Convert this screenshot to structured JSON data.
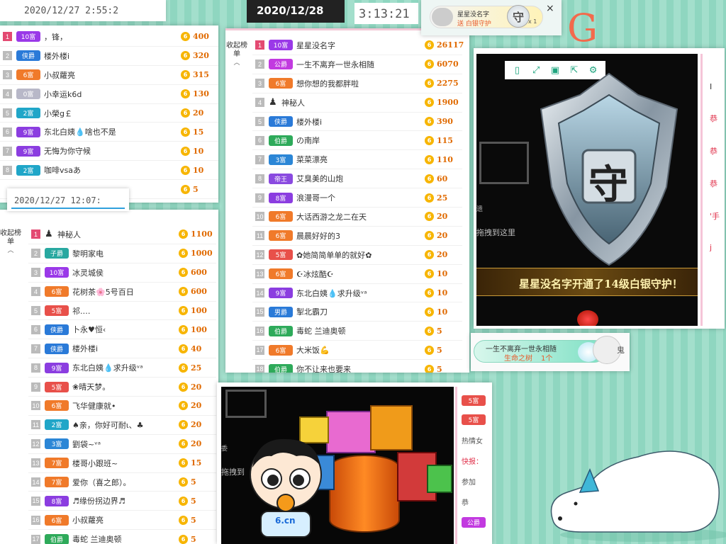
{
  "colors": {
    "rank_first": "#e34a72",
    "rank_default": "#bbbbbb",
    "coin": "#f7b500",
    "score": "#e06a00",
    "accent_teal": "#1fa57f"
  },
  "panel_top_left": {
    "timestamp": "2020/12/27 2:55:2",
    "rows": [
      {
        "rank": "1",
        "badge": "10富",
        "badge_color": "#9a39e8",
        "name": "，锋，",
        "score": "400"
      },
      {
        "rank": "2",
        "badge": "侠爵",
        "badge_color": "#2a7ad8",
        "name": "楼外楼i",
        "score": "320"
      },
      {
        "rank": "3",
        "badge": "6富",
        "badge_color": "#f07a2a",
        "name": "小叔蘿亮",
        "score": "315"
      },
      {
        "rank": "4",
        "badge": "0富",
        "badge_color": "#b8b8c8",
        "name": "小幸运k6d",
        "score": "130"
      },
      {
        "rank": "5",
        "badge": "2富",
        "badge_color": "#20a6c8",
        "name": "小榮g￡",
        "score": "20"
      },
      {
        "rank": "6",
        "badge": "9富",
        "badge_color": "#8b3de0",
        "name": "东北白姨💧啥也不是",
        "score": "15"
      },
      {
        "rank": "7",
        "badge": "9富",
        "badge_color": "#8b3de0",
        "name": "无悔为你守候",
        "score": "10"
      },
      {
        "rank": "8",
        "badge": "2富",
        "badge_color": "#20a6c8",
        "name": "咖啡vsaあ",
        "score": "10"
      },
      {
        "rank": "",
        "badge": "",
        "badge_color": "#ffffff",
        "name": "",
        "score": "5"
      }
    ]
  },
  "panel_bottom_left": {
    "timestamp": "2020/12/27 12:07:",
    "side_label": "收起榜单",
    "rows": [
      {
        "rank": "1",
        "badge": "",
        "badge_color": "#ffffff",
        "name": "神秘人",
        "score": "1100",
        "mystery": true
      },
      {
        "rank": "2",
        "badge": "子爵",
        "badge_color": "#28a8a0",
        "name": "黎明家电",
        "score": "1000"
      },
      {
        "rank": "3",
        "badge": "10富",
        "badge_color": "#9a39e8",
        "name": "冰灵城侯",
        "score": "600"
      },
      {
        "rank": "4",
        "badge": "6富",
        "badge_color": "#f07a2a",
        "name": "花树茶🌸5号百日",
        "score": "600"
      },
      {
        "rank": "5",
        "badge": "5富",
        "badge_color": "#e8504a",
        "name": "祁.…",
        "score": "100"
      },
      {
        "rank": "6",
        "badge": "侠爵",
        "badge_color": "#2a7ad8",
        "name": "卜永♥恒‹",
        "score": "100"
      },
      {
        "rank": "7",
        "badge": "侠爵",
        "badge_color": "#2a7ad8",
        "name": "楼外楼i",
        "score": "40"
      },
      {
        "rank": "8",
        "badge": "9富",
        "badge_color": "#8b3de0",
        "name": "东北白姨💧求升级ᵛᵃ",
        "score": "25"
      },
      {
        "rank": "9",
        "badge": "5富",
        "badge_color": "#e8504a",
        "name": "❀晴天梦。",
        "score": "20"
      },
      {
        "rank": "10",
        "badge": "6富",
        "badge_color": "#f07a2a",
        "name": "飞华健康就•",
        "score": "20"
      },
      {
        "rank": "11",
        "badge": "2富",
        "badge_color": "#20a6c8",
        "name": "♠亲，你好可耐ι、♣",
        "score": "20"
      },
      {
        "rank": "12",
        "badge": "3富",
        "badge_color": "#2b86d6",
        "name": "劉袋~ᵛᵃ",
        "score": "20"
      },
      {
        "rank": "13",
        "badge": "7富",
        "badge_color": "#f07a2a",
        "name": "楼哥小跟班~",
        "score": "15"
      },
      {
        "rank": "14",
        "badge": "7富",
        "badge_color": "#f07a2a",
        "name": "爱你（喜之郎）。",
        "score": "5"
      },
      {
        "rank": "15",
        "badge": "8富",
        "badge_color": "#8b3de0",
        "name": "♬缘份拐边界♬",
        "score": "5"
      },
      {
        "rank": "16",
        "badge": "6富",
        "badge_color": "#f07a2a",
        "name": "小叔蘿亮",
        "score": "5"
      },
      {
        "rank": "17",
        "badge": "伯爵",
        "badge_color": "#2eaa5a",
        "name": "毒蛇 兰迪奥顿",
        "score": "5"
      }
    ]
  },
  "panel_middle": {
    "side_label": "收起榜单",
    "rows": [
      {
        "rank": "1",
        "badge": "10富",
        "badge_color": "#9a39e8",
        "name": "星星没名字",
        "score": "26117"
      },
      {
        "rank": "2",
        "badge": "公爵",
        "badge_color": "#c23ae0",
        "name": "一生不离弃一世永相随",
        "score": "6070"
      },
      {
        "rank": "3",
        "badge": "6富",
        "badge_color": "#f07a2a",
        "name": "想你想的我都胖啦",
        "score": "2275"
      },
      {
        "rank": "4",
        "badge": "",
        "badge_color": "#ffffff",
        "name": "神秘人",
        "score": "1900",
        "mystery": true
      },
      {
        "rank": "5",
        "badge": "侠爵",
        "badge_color": "#2a7ad8",
        "name": "楼外楼i",
        "score": "390"
      },
      {
        "rank": "6",
        "badge": "伯爵",
        "badge_color": "#2eaa5a",
        "name": "の南岸",
        "score": "115"
      },
      {
        "rank": "7",
        "badge": "3富",
        "badge_color": "#2b86d6",
        "name": "菜菜漂亮",
        "score": "110"
      },
      {
        "rank": "8",
        "badge": "帝王",
        "badge_color": "#8a4ae0",
        "name": "艾臭美的山炮",
        "score": "60"
      },
      {
        "rank": "9",
        "badge": "8富",
        "badge_color": "#8b3de0",
        "name": "浪漫哥一个",
        "score": "25"
      },
      {
        "rank": "10",
        "badge": "6富",
        "badge_color": "#f07a2a",
        "name": "大话西游之龙二在天",
        "score": "20"
      },
      {
        "rank": "11",
        "badge": "6富",
        "badge_color": "#f07a2a",
        "name": "晨晨好好的3",
        "score": "20"
      },
      {
        "rank": "12",
        "badge": "5富",
        "badge_color": "#e8504a",
        "name": "✿她简简单单的就好✿",
        "score": "20"
      },
      {
        "rank": "13",
        "badge": "6富",
        "badge_color": "#f07a2a",
        "name": "☪冰炫酷☪",
        "score": "10"
      },
      {
        "rank": "14",
        "badge": "9富",
        "badge_color": "#8b3de0",
        "name": "东北白姨💧求升级ᵛᵃ",
        "score": "10"
      },
      {
        "rank": "15",
        "badge": "男爵",
        "badge_color": "#2a7ad8",
        "name": "掣北霸刀",
        "score": "10"
      },
      {
        "rank": "16",
        "badge": "伯爵",
        "badge_color": "#2eaa5a",
        "name": "毒蛇 兰迪奥顿",
        "score": "5"
      },
      {
        "rank": "17",
        "badge": "6富",
        "badge_color": "#f07a2a",
        "name": "大米饭💪",
        "score": "5"
      },
      {
        "rank": "18",
        "badge": "伯爵",
        "badge_color": "#2eaa5a",
        "name": "你不让来也要来",
        "score": "5"
      }
    ]
  },
  "date_badge": {
    "date": "2020/12/28",
    "time": "3:13:21"
  },
  "gift_notice": {
    "name": "星星没名字",
    "line2": "送 白银守护",
    "badge_char": "守",
    "qty": "x 1",
    "close": "×"
  },
  "bg_decoration": {
    "text": "G Anight"
  },
  "guardian_panel": {
    "shield_char": "守",
    "announce": "星星没名字开通了14级白银守护！",
    "drag_hint": "拖拽到这里",
    "drag_fragment": "遗",
    "side_fragments": [
      "I",
      "恭",
      "恭",
      "恭",
      "'手",
      "j"
    ]
  },
  "tree_notice": {
    "line1": "一生不离弃一世永相随",
    "line2_prefix": "生命之树",
    "line2_count": "1个",
    "side_char": "鬼"
  },
  "gift_panel": {
    "drag_hint": "拖拽到",
    "drag_fragment": "委",
    "mascot_text": "6.cn",
    "side_items": [
      {
        "badge": "5富",
        "badge_color": "#e8504a"
      },
      {
        "badge": "5富",
        "badge_color": "#e8504a"
      }
    ],
    "side_texts": [
      "热情女",
      "快报：",
      "参加",
      "恭"
    ],
    "side_bottom_badge": {
      "badge": "公爵",
      "badge_color": "#c23ae0"
    }
  }
}
